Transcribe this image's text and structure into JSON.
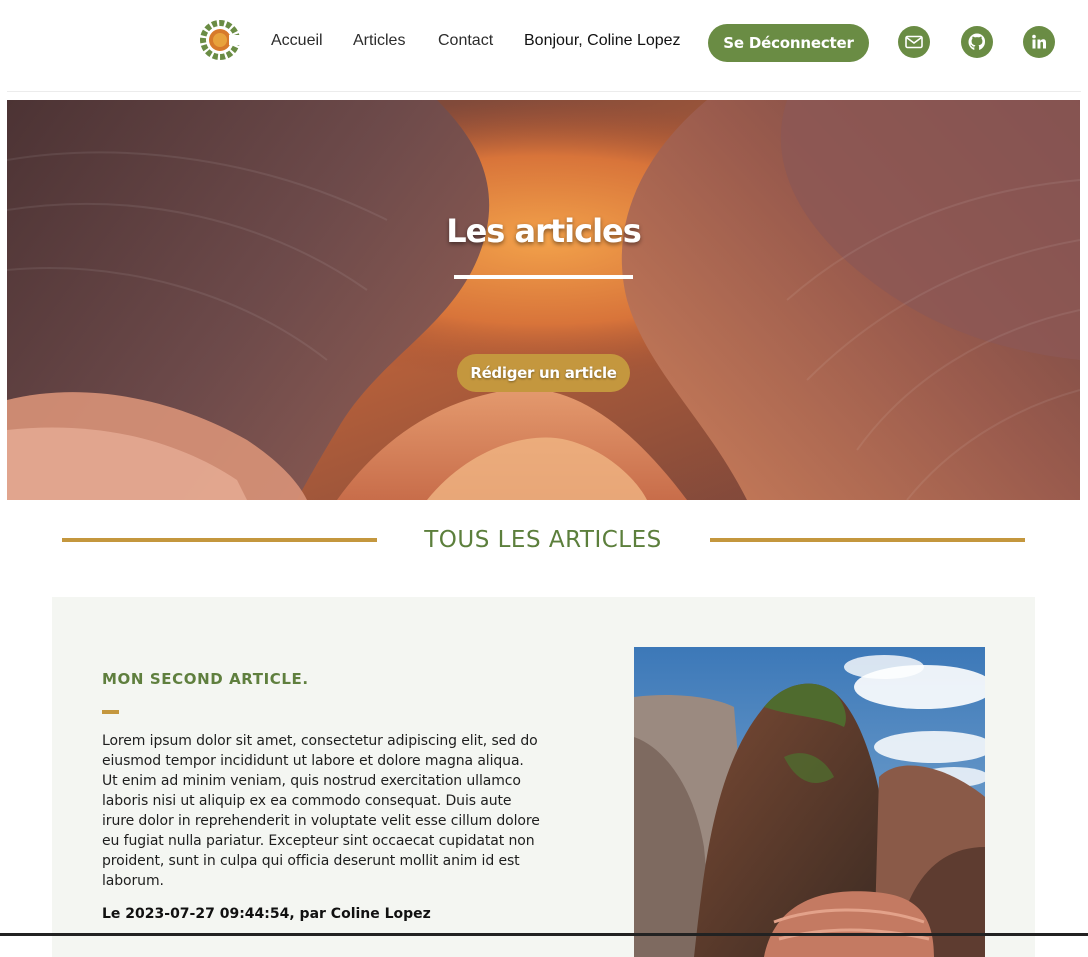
{
  "header": {
    "nav": [
      {
        "label": "Accueil"
      },
      {
        "label": "Articles"
      },
      {
        "label": "Contact"
      }
    ],
    "greeting": "Bonjour, Coline Lopez",
    "logout_label": "Se Déconnecter",
    "social_icons": [
      "mail-icon",
      "github-icon",
      "linkedin-icon"
    ]
  },
  "hero": {
    "title": "Les articles",
    "cta_label": "Rédiger un article"
  },
  "section": {
    "title": "TOUS LES ARTICLES"
  },
  "article": {
    "title": "MON SECOND ARTICLE.",
    "body": "Lorem ipsum dolor sit amet, consectetur adipiscing elit, sed do eiusmod tempor incididunt ut labore et dolore magna aliqua. Ut enim ad minim veniam, quis nostrud exercitation ullamco laboris nisi ut aliquip ex ea commodo consequat. Duis aute irure dolor in reprehenderit in voluptate velit esse cillum dolore eu fugiat nulla pariatur. Excepteur sint occaecat cupidatat non proident, sunt in culpa qui officia deserunt mollit anim id est laborum.",
    "meta": "Le 2023-07-27 09:44:54, par Coline Lopez"
  },
  "colors": {
    "brand_green": "#6a8c44",
    "accent_gold": "#c4973e",
    "heading_green": "#5c7f3c",
    "card_bg": "#f4f6f2"
  }
}
